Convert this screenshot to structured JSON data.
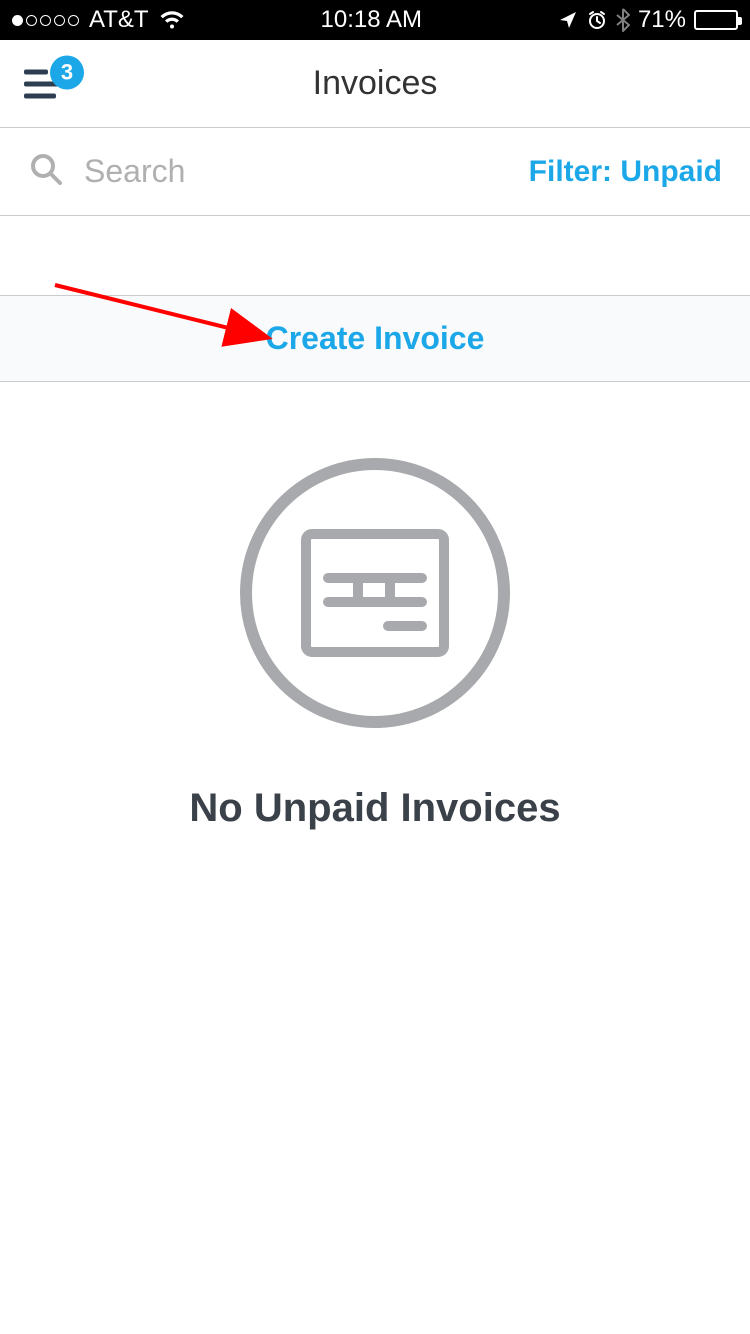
{
  "status": {
    "carrier": "AT&T",
    "time": "10:18 AM",
    "battery_pct": "71%",
    "battery_fill_pct": 71
  },
  "nav": {
    "title": "Invoices",
    "menu_badge": "3"
  },
  "search": {
    "placeholder": "Search",
    "filter_label": "Filter: Unpaid"
  },
  "actions": {
    "create_label": "Create Invoice"
  },
  "empty": {
    "title": "No Unpaid Invoices"
  }
}
